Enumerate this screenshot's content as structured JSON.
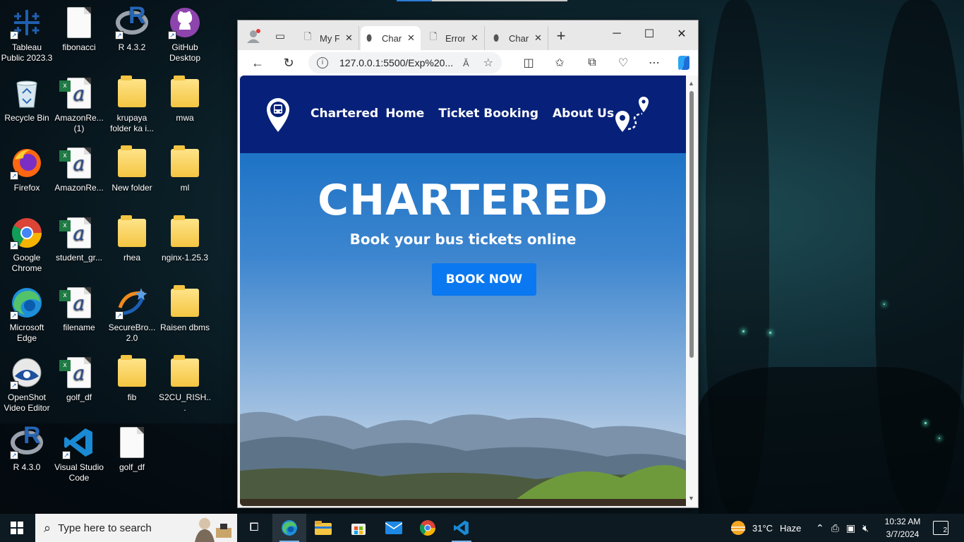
{
  "desktop": {
    "icons": [
      {
        "label": "Tableau Public 2023.3",
        "icon": "tableau-icon"
      },
      {
        "label": "fibonacci",
        "icon": "file-icon"
      },
      {
        "label": "R 4.3.2",
        "icon": "r-icon"
      },
      {
        "label": "GitHub Desktop",
        "icon": "github-icon"
      },
      {
        "label": "Recycle Bin",
        "icon": "recycle-bin-icon"
      },
      {
        "label": "AmazonRe... (1)",
        "icon": "csv-icon"
      },
      {
        "label": "krupaya folder ka i...",
        "icon": "folder-icon"
      },
      {
        "label": "mwa",
        "icon": "folder-icon"
      },
      {
        "label": "Firefox",
        "icon": "firefox-icon"
      },
      {
        "label": "AmazonRe...",
        "icon": "csv-icon"
      },
      {
        "label": "New folder",
        "icon": "folder-icon"
      },
      {
        "label": "ml",
        "icon": "folder-icon"
      },
      {
        "label": "Google Chrome",
        "icon": "chrome-icon"
      },
      {
        "label": "student_gr...",
        "icon": "csv-icon"
      },
      {
        "label": "rhea",
        "icon": "folder-icon"
      },
      {
        "label": "nginx-1.25.3",
        "icon": "folder-icon"
      },
      {
        "label": "Microsoft Edge",
        "icon": "edge-icon"
      },
      {
        "label": "filename",
        "icon": "csv-icon"
      },
      {
        "label": "SecureBro... 2.0",
        "icon": "securebrowser-icon"
      },
      {
        "label": "Raisen dbms",
        "icon": "folder-icon"
      },
      {
        "label": "OpenShot Video Editor",
        "icon": "openshot-icon"
      },
      {
        "label": "golf_df",
        "icon": "csv-icon"
      },
      {
        "label": "fib",
        "icon": "folder-icon"
      },
      {
        "label": "S2CU_RISH...",
        "icon": "folder-icon"
      },
      {
        "label": "R 4.3.0",
        "icon": "r-icon"
      },
      {
        "label": "Visual Studio Code",
        "icon": "vscode-icon"
      },
      {
        "label": "golf_df",
        "icon": "file-icon"
      }
    ]
  },
  "browser": {
    "tabs": [
      {
        "title": "My F",
        "icon": "page-icon",
        "active": false
      },
      {
        "title": "Char",
        "icon": "location-pin-icon",
        "active": true
      },
      {
        "title": "Error",
        "icon": "page-icon",
        "active": false
      },
      {
        "title": "Char",
        "icon": "location-pin-icon",
        "active": false
      }
    ],
    "new_tab": "+",
    "url": "127.0.0.1:5500/Exp%20...",
    "read_aloud": "Ă"
  },
  "site": {
    "nav": [
      "Chartered",
      "Home",
      "Ticket Booking",
      "About Us"
    ],
    "hero_title": "CHARTERED",
    "hero_subtitle": "Book your bus tickets online",
    "cta": "BOOK NOW"
  },
  "taskbar": {
    "search_placeholder": "Type here to search",
    "weather_temp": "31°C",
    "weather_text": "Haze",
    "time": "10:32 AM",
    "date": "3/7/2024",
    "notifications": "2"
  },
  "colors": {
    "site_header": "#07217a",
    "cta": "#0a78f0",
    "taskbar": "#0d1a22"
  }
}
